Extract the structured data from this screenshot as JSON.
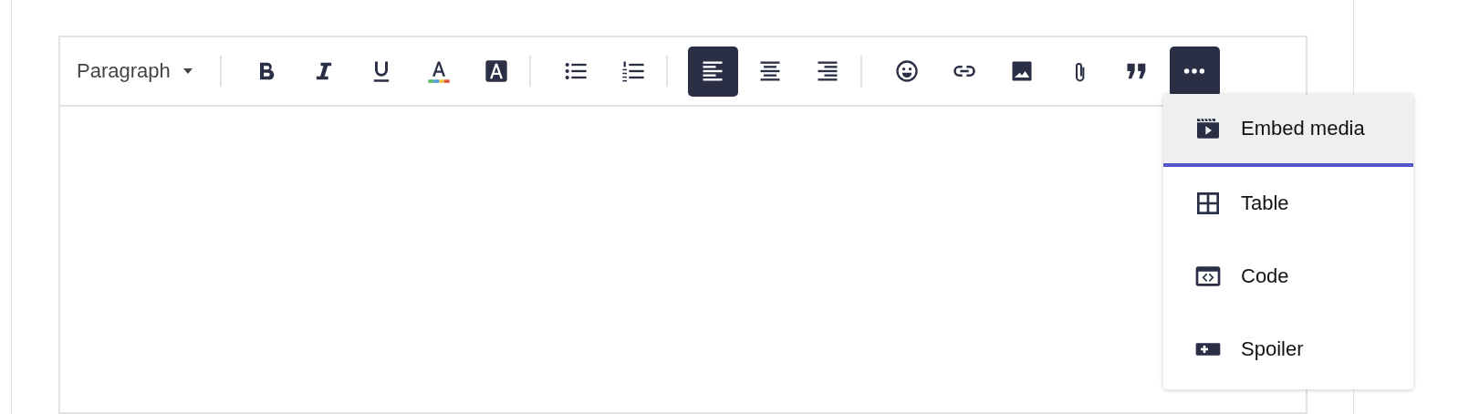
{
  "toolbar": [
    {
      "kind": "dropdown",
      "label": "Paragraph"
    },
    {
      "kind": "separator"
    },
    {
      "kind": "bold",
      "selected": false
    },
    {
      "kind": "italic",
      "selected": false
    },
    {
      "kind": "underline",
      "selected": false
    },
    {
      "kind": "text-color",
      "selected": false
    },
    {
      "kind": "highlight",
      "selected": false
    },
    {
      "kind": "separator"
    },
    {
      "kind": "bullet-list",
      "selected": false
    },
    {
      "kind": "numbered-list",
      "selected": false
    },
    {
      "kind": "separator"
    },
    {
      "kind": "align-left",
      "selected": true
    },
    {
      "kind": "align-center",
      "selected": false
    },
    {
      "kind": "align-right",
      "selected": false
    },
    {
      "kind": "separator"
    },
    {
      "kind": "emoji",
      "selected": false
    },
    {
      "kind": "link",
      "selected": false
    },
    {
      "kind": "image",
      "selected": false
    },
    {
      "kind": "attachment",
      "selected": false
    },
    {
      "kind": "quote",
      "selected": false
    },
    {
      "kind": "more",
      "selected": true
    }
  ],
  "menu": [
    {
      "kind": "media",
      "label": "Embed media",
      "selected": true
    },
    {
      "kind": "table",
      "label": "Table",
      "selected": false
    },
    {
      "kind": "code",
      "label": "Code",
      "selected": false
    },
    {
      "kind": "spoiler",
      "label": "Spoiler",
      "selected": false
    }
  ]
}
